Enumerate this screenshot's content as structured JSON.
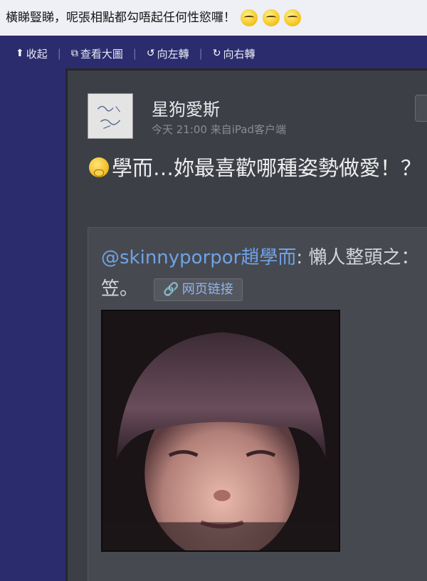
{
  "caption": {
    "text": "橫睇豎睇，呢張相點都勾唔起任何性慾囉！"
  },
  "toolbar": {
    "collapse": "收起",
    "view_large": "查看大圖",
    "rotate_left": "向左轉",
    "rotate_right": "向右轉"
  },
  "post": {
    "username": "星狗愛斯",
    "meta": "今天 21:00  来自iPad客户端",
    "text": "學而…妳最喜歡哪種姿勢做愛！？",
    "repost": {
      "mention": "@skinnyporpor趙學而",
      "text": ": 懶人整頭之：笠。",
      "link_label": "网页链接"
    }
  },
  "icons": {
    "emoji_caption": "squinting-face-emoji",
    "emoji_post": "thinking-face-emoji",
    "collapse_icon": "arrow-up-icon",
    "view_large_icon": "external-link-icon",
    "rotate_left_icon": "rotate-left-icon",
    "rotate_right_icon": "rotate-right-icon",
    "link_icon": "link-icon"
  }
}
